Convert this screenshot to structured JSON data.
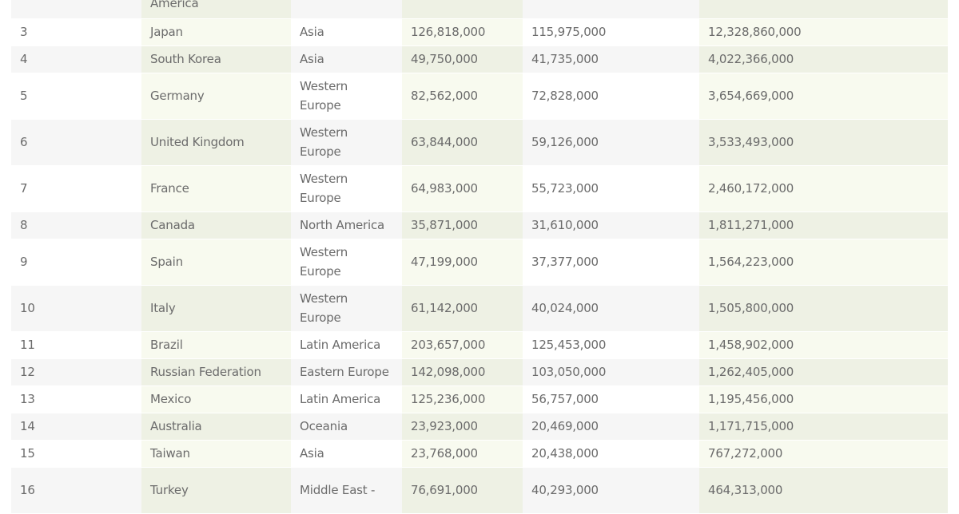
{
  "table": {
    "top_partial": {
      "country": "America",
      "population": "",
      "users": "",
      "revenue": ""
    },
    "rows": [
      {
        "rank": "3",
        "country": "Japan",
        "region": "Asia",
        "population": "126,818,000",
        "users": "115,975,000",
        "revenue": "12,328,860,000"
      },
      {
        "rank": "4",
        "country": "South Korea",
        "region": "Asia",
        "population": "49,750,000",
        "users": "41,735,000",
        "revenue": "4,022,366,000"
      },
      {
        "rank": "5",
        "country": "Germany",
        "region": "Western Europe",
        "population": "82,562,000",
        "users": "72,828,000",
        "revenue": "3,654,669,000"
      },
      {
        "rank": "6",
        "country": "United Kingdom",
        "region": "Western Europe",
        "population": "63,844,000",
        "users": "59,126,000",
        "revenue": "3,533,493,000"
      },
      {
        "rank": "7",
        "country": "France",
        "region": "Western Europe",
        "population": "64,983,000",
        "users": "55,723,000",
        "revenue": "2,460,172,000"
      },
      {
        "rank": "8",
        "country": "Canada",
        "region": "North America",
        "population": "35,871,000",
        "users": "31,610,000",
        "revenue": "1,811,271,000"
      },
      {
        "rank": "9",
        "country": "Spain",
        "region": "Western Europe",
        "population": "47,199,000",
        "users": "37,377,000",
        "revenue": "1,564,223,000"
      },
      {
        "rank": "10",
        "country": "Italy",
        "region": "Western Europe",
        "population": "61,142,000",
        "users": "40,024,000",
        "revenue": "1,505,800,000"
      },
      {
        "rank": "11",
        "country": "Brazil",
        "region": "Latin America",
        "population": "203,657,000",
        "users": "125,453,000",
        "revenue": "1,458,902,000"
      },
      {
        "rank": "12",
        "country": "Russian Federation",
        "region": "Eastern Europe",
        "population": "142,098,000",
        "users": "103,050,000",
        "revenue": "1,262,405,000"
      },
      {
        "rank": "13",
        "country": "Mexico",
        "region": "Latin America",
        "population": "125,236,000",
        "users": "56,757,000",
        "revenue": "1,195,456,000"
      },
      {
        "rank": "14",
        "country": "Australia",
        "region": "Oceania",
        "population": "23,923,000",
        "users": "20,469,000",
        "revenue": "1,171,715,000"
      },
      {
        "rank": "15",
        "country": "Taiwan",
        "region": "Asia",
        "population": "23,768,000",
        "users": "20,438,000",
        "revenue": "767,272,000"
      },
      {
        "rank": "16",
        "country": "Turkey",
        "region": "Middle East -",
        "population": "76,691,000",
        "users": "40,293,000",
        "revenue": "464,313,000"
      }
    ]
  }
}
